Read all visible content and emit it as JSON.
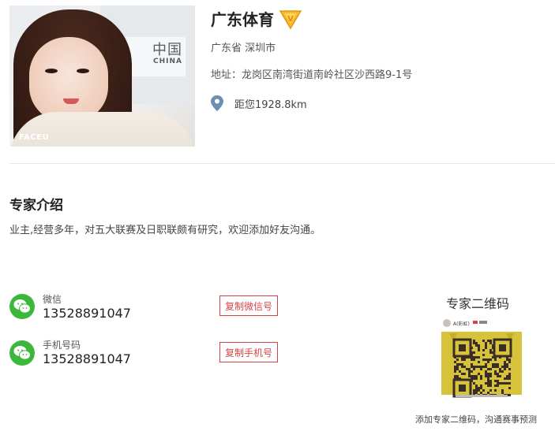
{
  "profile": {
    "name": "广东体育",
    "region": "广东省 深圳市",
    "address": "地址：龙岗区南湾街道南岭社区沙西路9-1号",
    "distance": "距您1928.8km",
    "photo_watermark": "FACEU",
    "photo_sign_text": "中国",
    "photo_sign_sub": "CHINA"
  },
  "intro": {
    "title": "专家介绍",
    "text": "业主,经营多年，对五大联赛及日职联颇有研究，欢迎添加好友沟通。"
  },
  "contacts": [
    {
      "label": "微信",
      "value": "13528891047",
      "button": "复制微信号"
    },
    {
      "label": "手机号码",
      "value": "13528891047",
      "button": "复制手机号"
    }
  ],
  "qr": {
    "title": "专家二维码",
    "card_name": "A(彩虹)",
    "footer": "添加专家二维码，沟通赛事预测"
  },
  "colors": {
    "wechat_green": "#3cb73c",
    "button_red": "#d64545",
    "badge_gold": "#f5b82e",
    "pin_blue": "#6b8fb0",
    "qr_yellow": "#d7c33a"
  }
}
